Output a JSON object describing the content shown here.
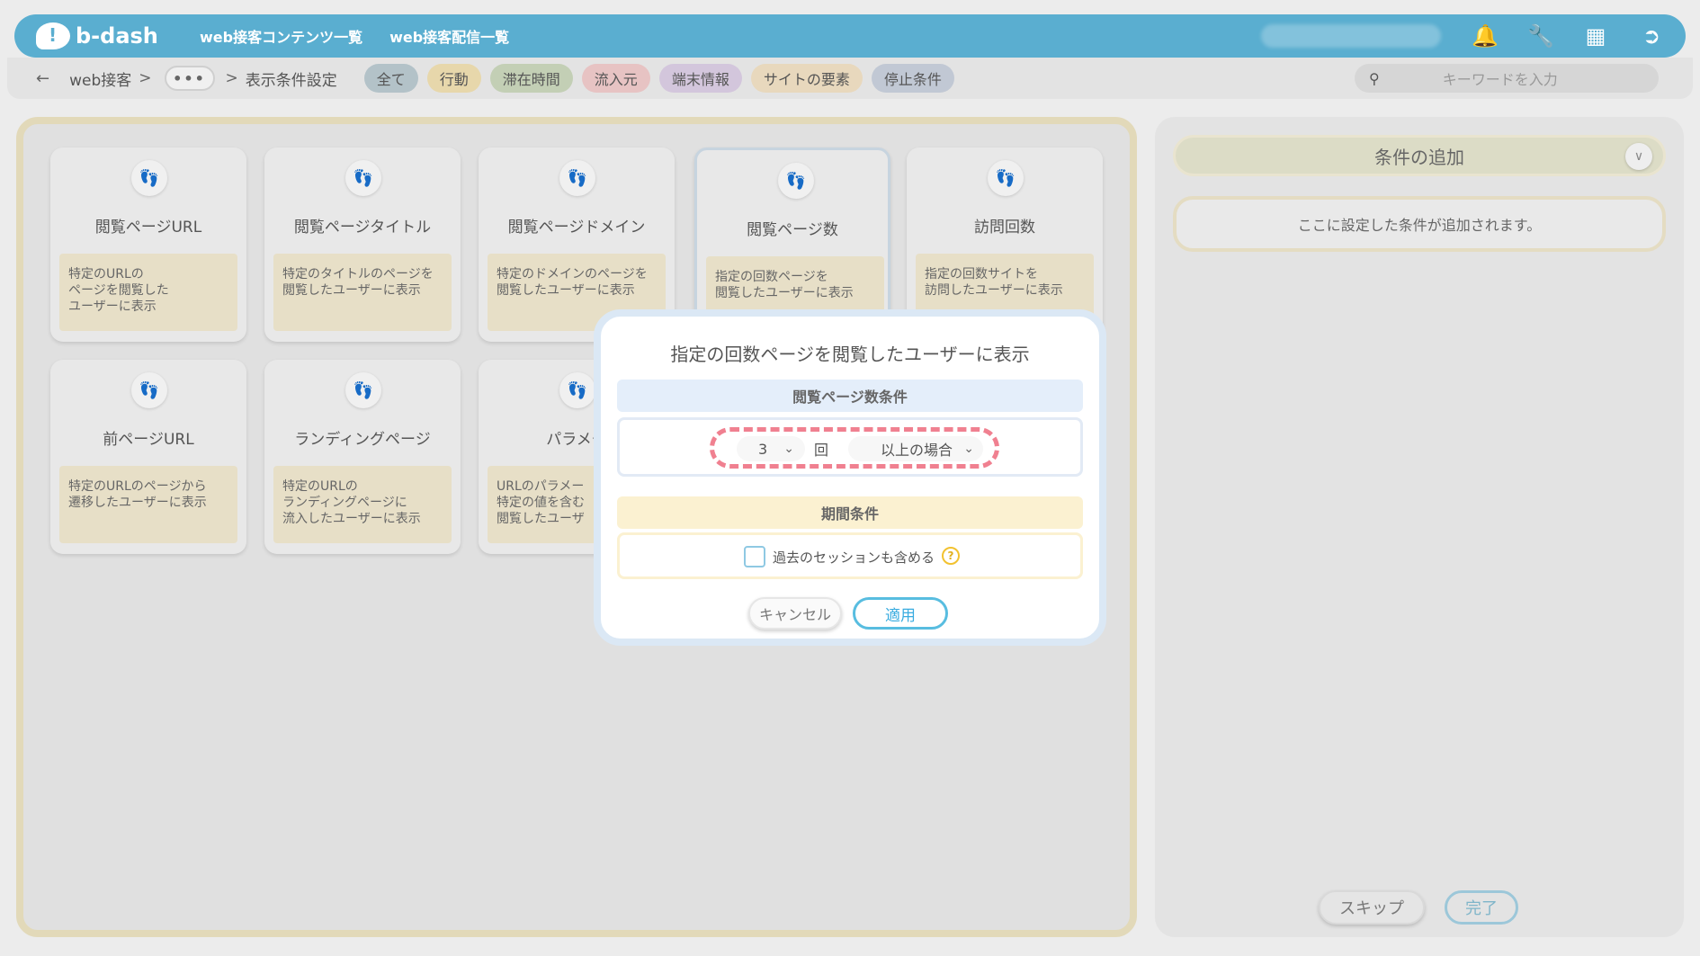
{
  "header": {
    "logo_text": "b-dash",
    "nav": [
      "web接客コンテンツ一覧",
      "web接客配信一覧"
    ],
    "icons": [
      "bell-icon",
      "wrench-icon",
      "grid-icon",
      "logout-icon"
    ]
  },
  "breadcrumb": {
    "back": "←",
    "root": "web接客",
    "sep": ">",
    "ellipsis": "•••",
    "current": "表示条件設定"
  },
  "filters": [
    "全て",
    "行動",
    "滞在時間",
    "流入元",
    "端末情報",
    "サイトの要素",
    "停止条件"
  ],
  "search": {
    "placeholder": "キーワードを入力"
  },
  "cards": [
    {
      "title": "閲覧ページURL",
      "desc": "特定のURLの\nページを閲覧した\nユーザーに表示"
    },
    {
      "title": "閲覧ページタイトル",
      "desc": "特定のタイトルのページを\n閲覧したユーザーに表示"
    },
    {
      "title": "閲覧ページドメイン",
      "desc": "特定のドメインのページを\n閲覧したユーザーに表示"
    },
    {
      "title": "閲覧ページ数",
      "desc": "指定の回数ページを\n閲覧したユーザーに表示"
    },
    {
      "title": "訪問回数",
      "desc": "指定の回数サイトを\n訪問したユーザーに表示"
    },
    {
      "title": "前ページURL",
      "desc": "特定のURLのページから\n遷移したユーザーに表示"
    },
    {
      "title": "ランディングページ",
      "desc": "特定のURLの\nランディングページに\n流入したユーザーに表示"
    },
    {
      "title": "パラメー",
      "desc": "URLのパラメー\n特定の値を含む\n閲覧したユーザ"
    }
  ],
  "right_panel": {
    "title": "条件の追加",
    "placeholder": "ここに設定した条件が追加されます。",
    "skip": "スキップ",
    "done": "完了"
  },
  "modal": {
    "title": "指定の回数ページを閲覧したユーザーに表示",
    "section1": "閲覧ページ数条件",
    "count_value": "3",
    "times_label": "回",
    "condition_value": "以上の場合",
    "section2": "期間条件",
    "checkbox_label": "過去のセッションも含める",
    "help": "?",
    "cancel": "キャンセル",
    "apply": "適用"
  }
}
